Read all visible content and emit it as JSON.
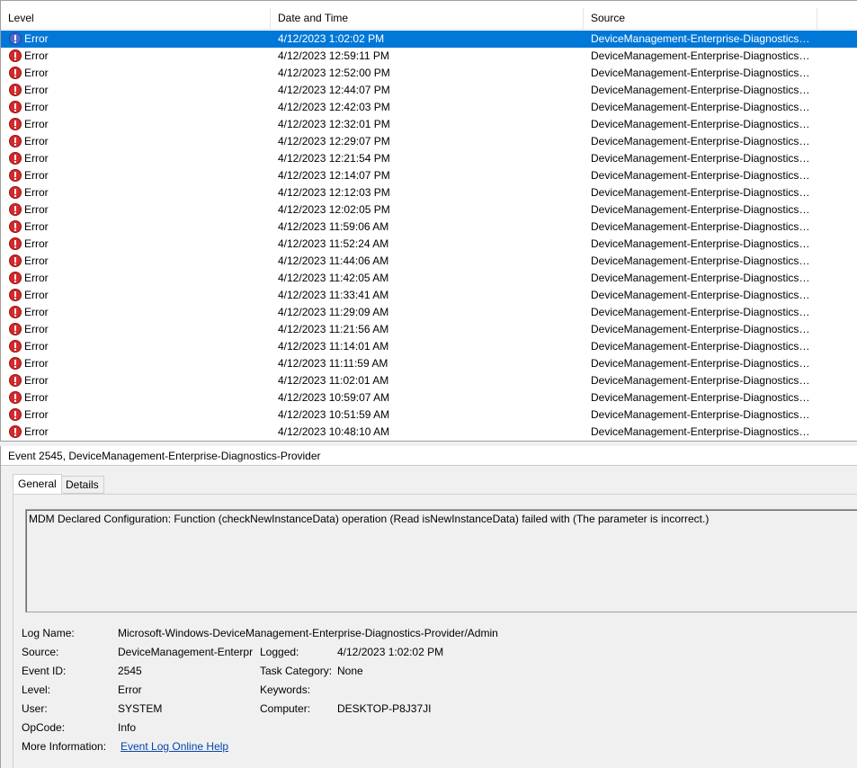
{
  "columns": {
    "level": "Level",
    "date": "Date and Time",
    "source": "Source"
  },
  "events": [
    {
      "level": "Error",
      "date": "4/12/2023 1:02:02 PM",
      "source": "DeviceManagement-Enterprise-Diagnostics-...",
      "selected": true
    },
    {
      "level": "Error",
      "date": "4/12/2023 12:59:11 PM",
      "source": "DeviceManagement-Enterprise-Diagnostics-..."
    },
    {
      "level": "Error",
      "date": "4/12/2023 12:52:00 PM",
      "source": "DeviceManagement-Enterprise-Diagnostics-..."
    },
    {
      "level": "Error",
      "date": "4/12/2023 12:44:07 PM",
      "source": "DeviceManagement-Enterprise-Diagnostics-..."
    },
    {
      "level": "Error",
      "date": "4/12/2023 12:42:03 PM",
      "source": "DeviceManagement-Enterprise-Diagnostics-..."
    },
    {
      "level": "Error",
      "date": "4/12/2023 12:32:01 PM",
      "source": "DeviceManagement-Enterprise-Diagnostics-..."
    },
    {
      "level": "Error",
      "date": "4/12/2023 12:29:07 PM",
      "source": "DeviceManagement-Enterprise-Diagnostics-..."
    },
    {
      "level": "Error",
      "date": "4/12/2023 12:21:54 PM",
      "source": "DeviceManagement-Enterprise-Diagnostics-..."
    },
    {
      "level": "Error",
      "date": "4/12/2023 12:14:07 PM",
      "source": "DeviceManagement-Enterprise-Diagnostics-..."
    },
    {
      "level": "Error",
      "date": "4/12/2023 12:12:03 PM",
      "source": "DeviceManagement-Enterprise-Diagnostics-..."
    },
    {
      "level": "Error",
      "date": "4/12/2023 12:02:05 PM",
      "source": "DeviceManagement-Enterprise-Diagnostics-..."
    },
    {
      "level": "Error",
      "date": "4/12/2023 11:59:06 AM",
      "source": "DeviceManagement-Enterprise-Diagnostics-..."
    },
    {
      "level": "Error",
      "date": "4/12/2023 11:52:24 AM",
      "source": "DeviceManagement-Enterprise-Diagnostics-..."
    },
    {
      "level": "Error",
      "date": "4/12/2023 11:44:06 AM",
      "source": "DeviceManagement-Enterprise-Diagnostics-..."
    },
    {
      "level": "Error",
      "date": "4/12/2023 11:42:05 AM",
      "source": "DeviceManagement-Enterprise-Diagnostics-..."
    },
    {
      "level": "Error",
      "date": "4/12/2023 11:33:41 AM",
      "source": "DeviceManagement-Enterprise-Diagnostics-..."
    },
    {
      "level": "Error",
      "date": "4/12/2023 11:29:09 AM",
      "source": "DeviceManagement-Enterprise-Diagnostics-..."
    },
    {
      "level": "Error",
      "date": "4/12/2023 11:21:56 AM",
      "source": "DeviceManagement-Enterprise-Diagnostics-..."
    },
    {
      "level": "Error",
      "date": "4/12/2023 11:14:01 AM",
      "source": "DeviceManagement-Enterprise-Diagnostics-..."
    },
    {
      "level": "Error",
      "date": "4/12/2023 11:11:59 AM",
      "source": "DeviceManagement-Enterprise-Diagnostics-..."
    },
    {
      "level": "Error",
      "date": "4/12/2023 11:02:01 AM",
      "source": "DeviceManagement-Enterprise-Diagnostics-..."
    },
    {
      "level": "Error",
      "date": "4/12/2023 10:59:07 AM",
      "source": "DeviceManagement-Enterprise-Diagnostics-..."
    },
    {
      "level": "Error",
      "date": "4/12/2023 10:51:59 AM",
      "source": "DeviceManagement-Enterprise-Diagnostics-..."
    },
    {
      "level": "Error",
      "date": "4/12/2023 10:48:10 AM",
      "source": "DeviceManagement-Enterprise-Diagnostics-..."
    }
  ],
  "colors": {
    "selection": "#0078d7",
    "error_icon": "#d22b2b",
    "link": "#0645ad"
  },
  "detail": {
    "title": "Event 2545, DeviceManagement-Enterprise-Diagnostics-Provider",
    "tabs": {
      "general": "General",
      "details": "Details"
    },
    "message": "MDM Declared Configuration: Function (checkNewInstanceData) operation (Read isNewInstanceData) failed with (The parameter is incorrect.)",
    "labels": {
      "log_name": "Log Name:",
      "source": "Source:",
      "event_id": "Event ID:",
      "level": "Level:",
      "user": "User:",
      "opcode": "OpCode:",
      "more_info": "More Information:",
      "logged": "Logged:",
      "task_category": "Task Category:",
      "keywords": "Keywords:",
      "computer": "Computer:"
    },
    "values": {
      "log_name": "Microsoft-Windows-DeviceManagement-Enterprise-Diagnostics-Provider/Admin",
      "source": "DeviceManagement-Enterpr",
      "event_id": "2545",
      "level": "Error",
      "user": "SYSTEM",
      "opcode": "Info",
      "more_info_link": "Event Log Online Help",
      "logged": "4/12/2023 1:02:02 PM",
      "task_category": "None",
      "keywords": "",
      "computer": "DESKTOP-P8J37JI"
    }
  }
}
